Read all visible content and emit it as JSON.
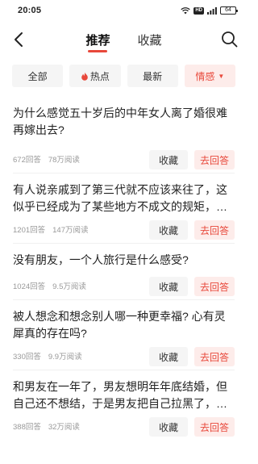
{
  "status": {
    "time": "20:05",
    "hd": "HD",
    "battery": "64"
  },
  "nav": {
    "tabs": [
      {
        "label": "推荐",
        "active": true
      },
      {
        "label": "收藏",
        "active": false
      }
    ]
  },
  "filters": [
    {
      "label": "全部"
    },
    {
      "label": "热点",
      "icon": "fire-icon"
    },
    {
      "label": "最新"
    },
    {
      "label": "情感",
      "selected": true,
      "caret": "▼"
    }
  ],
  "questions": [
    {
      "title": "为什么感觉五十岁后的中年女人离了婚很难再嫁出去?",
      "answers": "672回答",
      "views": "78万阅读"
    },
    {
      "title": "有人说亲戚到了第三代就不应该来往了，这似乎已经成为了某些地方不成文的规矩，你怎么看?",
      "answers": "1201回答",
      "views": "147万阅读"
    },
    {
      "title": "没有朋友，一个人旅行是什么感受?",
      "answers": "1024回答",
      "views": "9.5万阅读"
    },
    {
      "title": "被人想念和想念别人哪一种更幸福? 心有灵犀真的存在吗?",
      "answers": "330回答",
      "views": "9.9万阅读"
    },
    {
      "title": "和男友在一年了，男友想明年年底结婚，但自己还不想结，于是男友把自己拉黑了，你怎么看...",
      "answers": "388回答",
      "views": "32万阅读"
    }
  ],
  "actions": {
    "collect_label": "收藏",
    "answer_label": "去回答"
  }
}
